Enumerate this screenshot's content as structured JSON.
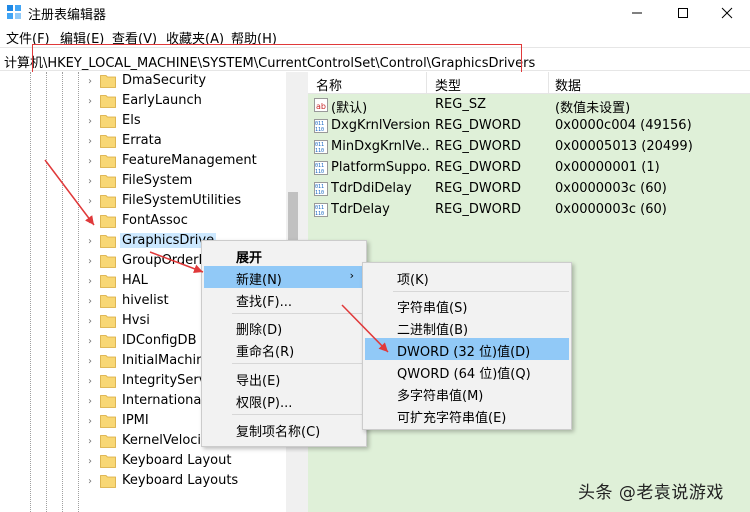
{
  "window": {
    "title": "注册表编辑器"
  },
  "menu": [
    "文件(F)",
    "编辑(E)",
    "查看(V)",
    "收藏夹(A)",
    "帮助(H)"
  ],
  "address": {
    "path": "计算机\\HKEY_LOCAL_MACHINE\\SYSTEM\\CurrentControlSet\\Control\\GraphicsDrivers"
  },
  "tree": {
    "items": [
      {
        "label": "DmaSecurity",
        "selected": false
      },
      {
        "label": "EarlyLaunch",
        "selected": false
      },
      {
        "label": "Els",
        "selected": false
      },
      {
        "label": "Errata",
        "selected": false
      },
      {
        "label": "FeatureManagement",
        "selected": false
      },
      {
        "label": "FileSystem",
        "selected": false
      },
      {
        "label": "FileSystemUtilities",
        "selected": false
      },
      {
        "label": "FontAssoc",
        "selected": false
      },
      {
        "label": "GraphicsDrive",
        "selected": true
      },
      {
        "label": "GroupOrderLi",
        "selected": false
      },
      {
        "label": "HAL",
        "selected": false
      },
      {
        "label": "hivelist",
        "selected": false
      },
      {
        "label": "Hvsi",
        "selected": false
      },
      {
        "label": "IDConfigDB",
        "selected": false
      },
      {
        "label": "InitialMachine",
        "selected": false
      },
      {
        "label": "IntegrityServic",
        "selected": false
      },
      {
        "label": "International",
        "selected": false
      },
      {
        "label": "IPMI",
        "selected": false
      },
      {
        "label": "KernelVelocity",
        "selected": false
      },
      {
        "label": "Keyboard Layout",
        "selected": false
      },
      {
        "label": "Keyboard Layouts",
        "selected": false
      }
    ]
  },
  "list": {
    "columns": [
      "名称",
      "类型",
      "数据"
    ],
    "rows": [
      {
        "icon": "string-value-icon",
        "name": "(默认)",
        "type": "REG_SZ",
        "data": "(数值未设置)"
      },
      {
        "icon": "binary-value-icon",
        "name": "DxgKrnlVersion",
        "type": "REG_DWORD",
        "data": "0x0000c004 (49156)"
      },
      {
        "icon": "binary-value-icon",
        "name": "MinDxgKrnlVe...",
        "type": "REG_DWORD",
        "data": "0x00005013 (20499)"
      },
      {
        "icon": "binary-value-icon",
        "name": "PlatformSuppo...",
        "type": "REG_DWORD",
        "data": "0x00000001 (1)"
      },
      {
        "icon": "binary-value-icon",
        "name": "TdrDdiDelay",
        "type": "REG_DWORD",
        "data": "0x0000003c (60)"
      },
      {
        "icon": "binary-value-icon",
        "name": "TdrDelay",
        "type": "REG_DWORD",
        "data": "0x0000003c (60)"
      }
    ]
  },
  "context_menu": {
    "items": [
      "展开",
      "新建(N)",
      "查找(F)...",
      "删除(D)",
      "重命名(R)",
      "导出(E)",
      "权限(P)...",
      "复制项名称(C)"
    ]
  },
  "submenu": {
    "items": [
      "项(K)",
      "字符串值(S)",
      "二进制值(B)",
      "DWORD (32 位)值(D)",
      "QWORD (64 位)值(Q)",
      "多字符串值(M)",
      "可扩充字符串值(E)"
    ]
  },
  "watermark": "头条 @老袁说游戏",
  "colors": {
    "values_bg": "#dff0d8",
    "menu_highlight": "#91c9f7",
    "annotation_red": "#e0393a"
  }
}
